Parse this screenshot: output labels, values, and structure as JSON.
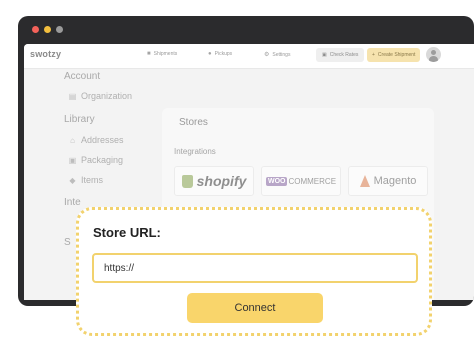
{
  "app": {
    "logo": "swotzy"
  },
  "topbar": {
    "nav": [
      {
        "label": "Shipments",
        "icon": "truck-icon"
      },
      {
        "label": "Pickups",
        "icon": "pin-icon"
      },
      {
        "label": "Settings",
        "icon": "gear-icon"
      }
    ],
    "check_rates": "Check Rates",
    "create_shipment": "Create Shipment"
  },
  "sidebar": {
    "account": {
      "heading": "Account",
      "items": [
        {
          "label": "Organization",
          "icon": "building-icon"
        }
      ]
    },
    "library": {
      "heading": "Library",
      "items": [
        {
          "label": "Addresses",
          "icon": "home-icon"
        },
        {
          "label": "Packaging",
          "icon": "box-icon"
        },
        {
          "label": "Items",
          "icon": "tag-icon"
        }
      ]
    },
    "integrations_heading_partial": "Inte",
    "extra_partial": "S"
  },
  "stores": {
    "title": "Stores",
    "integrations_label": "Integrations",
    "brands": {
      "shopify": "shopify",
      "woo_prefix": "WOO",
      "woo_suffix": "COMMERCE",
      "magento": "Magento"
    }
  },
  "modal": {
    "label": "Store URL:",
    "input_value": "https://",
    "connect": "Connect"
  },
  "colors": {
    "accent": "#f9d56b",
    "dotted_border": "#f2d26d",
    "window_frame": "#2b2b2d"
  }
}
